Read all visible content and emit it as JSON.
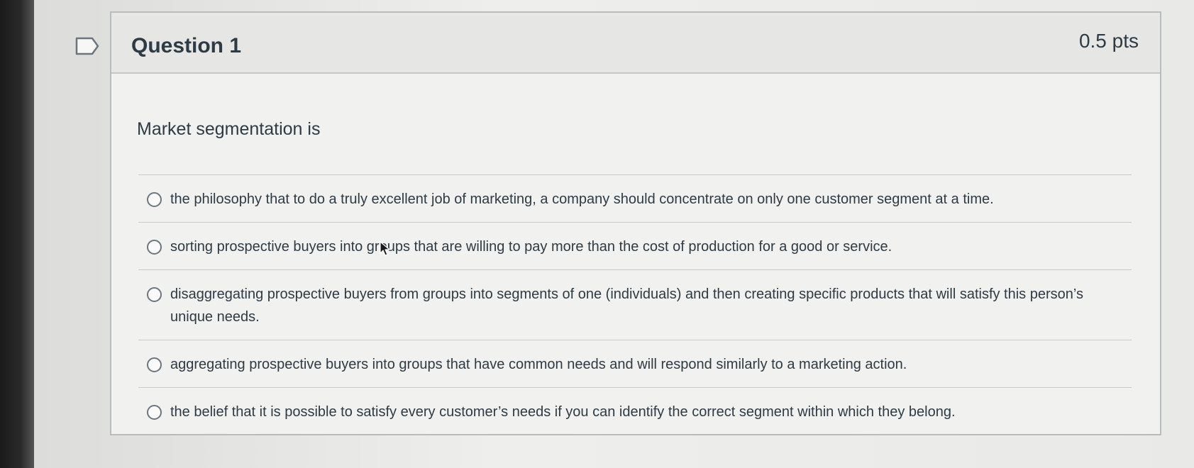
{
  "question": {
    "title": "Question 1",
    "points": "0.5 pts",
    "prompt": "Market segmentation is",
    "answers": [
      {
        "label": "the philosophy that to do a truly excellent job of marketing, a company should concentrate on only one customer segment at a time."
      },
      {
        "label": "sorting prospective buyers into groups that are willing to pay more than the cost of production for a good or service."
      },
      {
        "label": "disaggregating prospective buyers from groups into segments of one (individuals) and then creating specific products that will satisfy this person’s unique needs."
      },
      {
        "label": "aggregating prospective buyers into groups that have common needs and will respond similarly to a marketing action."
      },
      {
        "label": "the belief that it is possible to satisfy every customer’s needs if you can identify the correct segment within which they belong."
      }
    ]
  },
  "icons": {
    "flag": "flag-question-icon",
    "cursor": "mouse-pointer-icon"
  },
  "colors": {
    "text": "#2d3b45",
    "border": "#b9bcbd",
    "header_bg": "#e6e7e5"
  }
}
